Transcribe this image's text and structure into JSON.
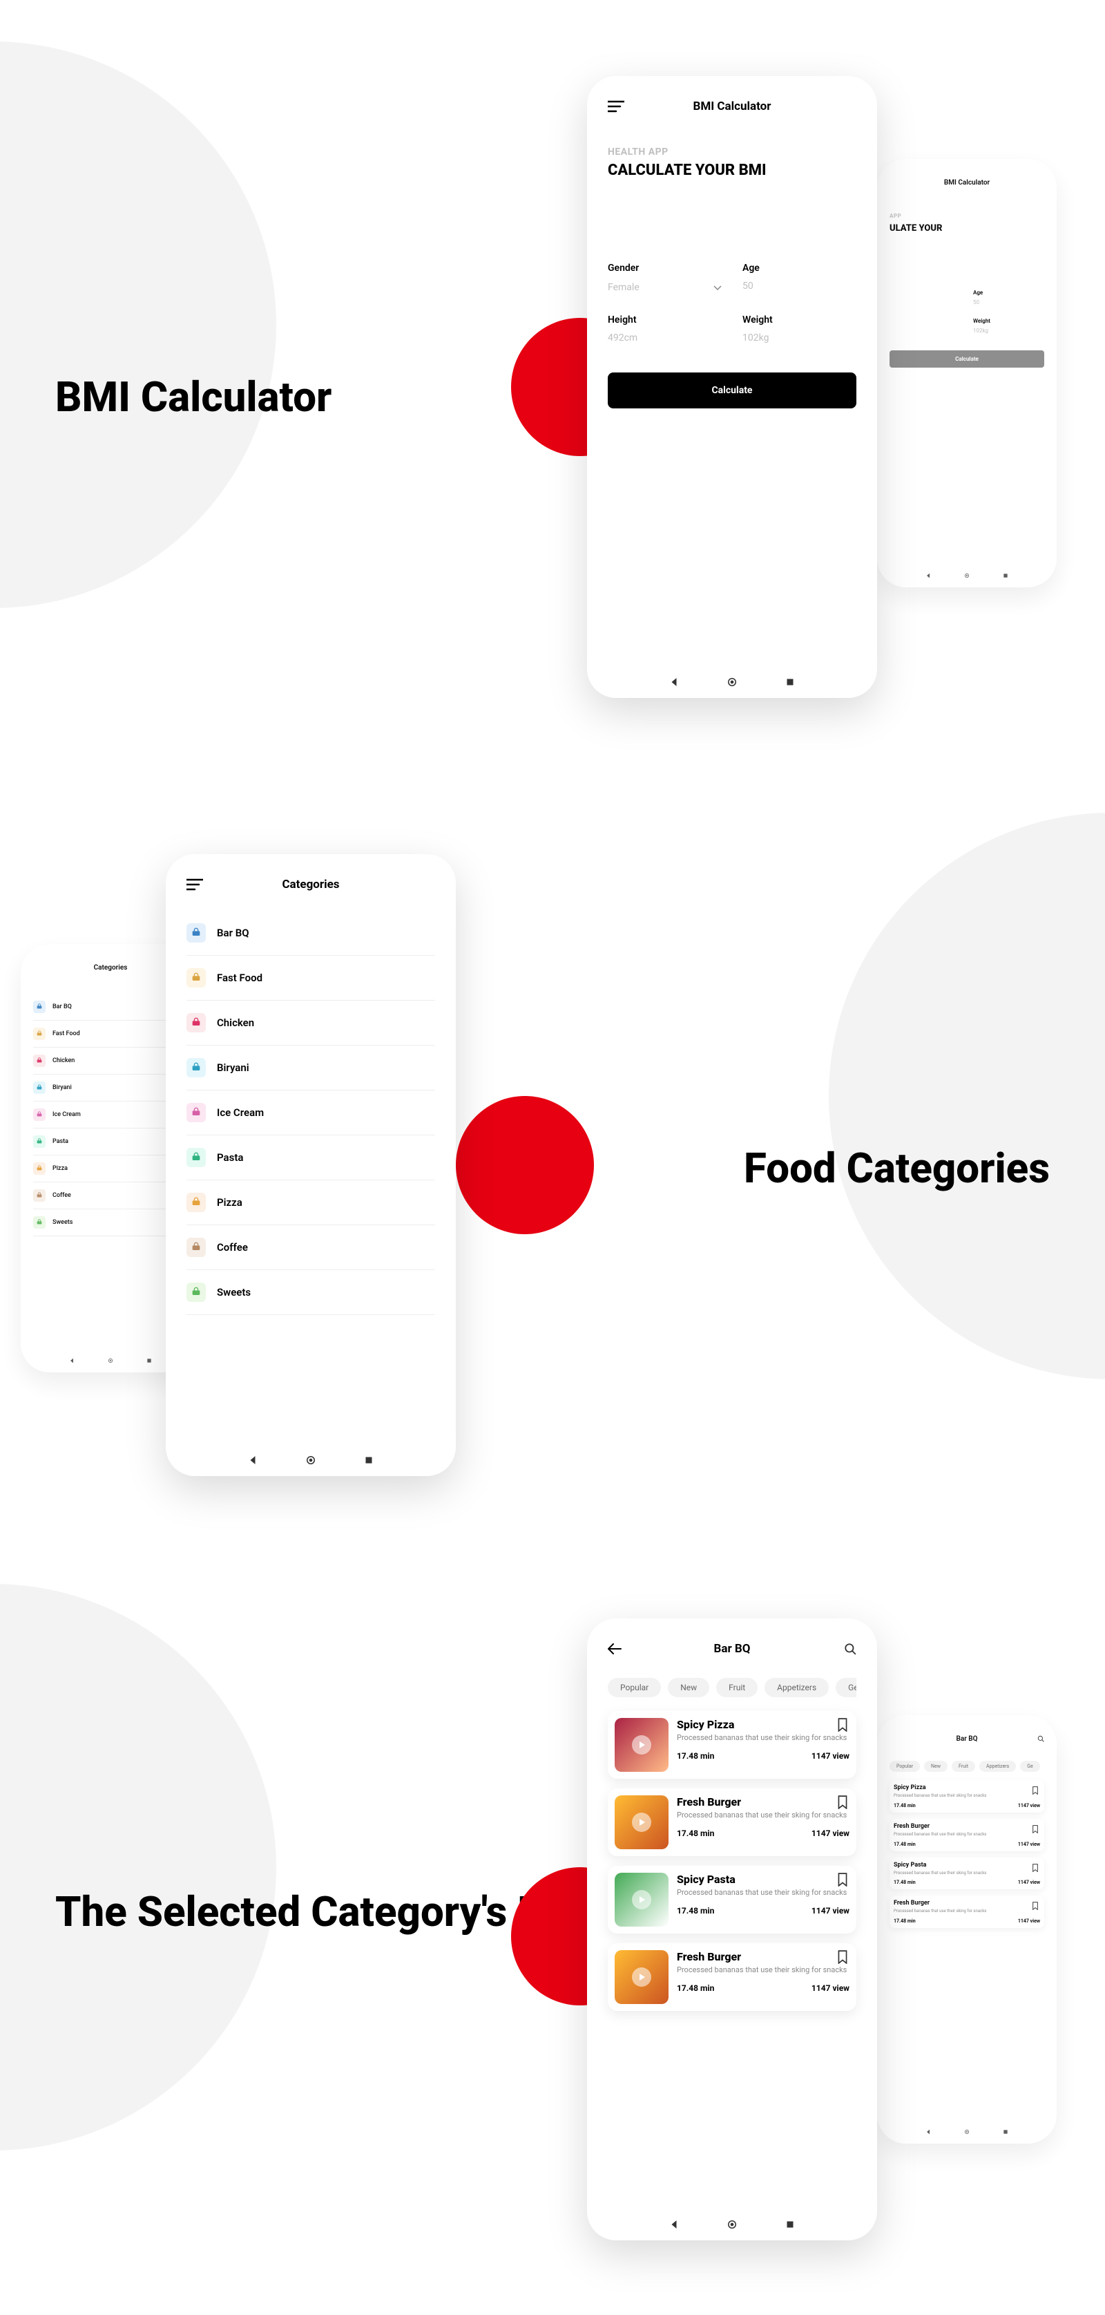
{
  "section1": {
    "title": "BMI Calculator",
    "phone": {
      "header": "BMI Calculator",
      "subtitle": "HEALTH APP",
      "main_title": "CALCULATE YOUR BMI",
      "fields": {
        "gender": {
          "label": "Gender",
          "value": "Female"
        },
        "age": {
          "label": "Age",
          "value": "50"
        },
        "height": {
          "label": "Height",
          "value": "492cm"
        },
        "weight": {
          "label": "Weight",
          "value": "102kg"
        }
      },
      "button": "Calculate"
    }
  },
  "section2": {
    "title": "Food Categories",
    "phone": {
      "header": "Categories",
      "items": [
        {
          "label": "Bar BQ",
          "icon_class": "ic-blue",
          "color": "#3b82c4"
        },
        {
          "label": "Fast Food",
          "icon_class": "ic-yellow",
          "color": "#d9a441"
        },
        {
          "label": "Chicken",
          "icon_class": "ic-pink",
          "color": "#d36"
        },
        {
          "label": "Biryani",
          "icon_class": "ic-cyan",
          "color": "#2da0c2"
        },
        {
          "label": "Ice Cream",
          "icon_class": "ic-pink2",
          "color": "#d65fa8"
        },
        {
          "label": "Pasta",
          "icon_class": "ic-teal",
          "color": "#2fb380"
        },
        {
          "label": "Pizza",
          "icon_class": "ic-orange",
          "color": "#e6a23c"
        },
        {
          "label": "Coffee",
          "icon_class": "ic-brown",
          "color": "#b58863"
        },
        {
          "label": "Sweets",
          "icon_class": "ic-green",
          "color": "#5cb85c"
        }
      ]
    }
  },
  "section3": {
    "title": "The Selected Category's List",
    "phone": {
      "header": "Bar BQ",
      "chips": [
        "Popular",
        "New",
        "Fruit",
        "Appetizers",
        "Ge"
      ],
      "items": [
        {
          "title": "Spicy Pizza",
          "desc": "Processed bananas that use their sking for snacks",
          "time": "17.48 min",
          "views": "1147 view",
          "img": "bg-pizza"
        },
        {
          "title": "Fresh Burger",
          "desc": "Processed bananas that use their sking for snacks",
          "time": "17.48 min",
          "views": "1147 view",
          "img": "bg-burger"
        },
        {
          "title": "Spicy Pasta",
          "desc": "Processed bananas that use their sking for snacks",
          "time": "17.48 min",
          "views": "1147 view",
          "img": "bg-pasta"
        },
        {
          "title": "Fresh Burger",
          "desc": "Processed bananas that use their sking for snacks",
          "time": "17.48 min",
          "views": "1147 view",
          "img": "bg-burger"
        }
      ]
    }
  }
}
